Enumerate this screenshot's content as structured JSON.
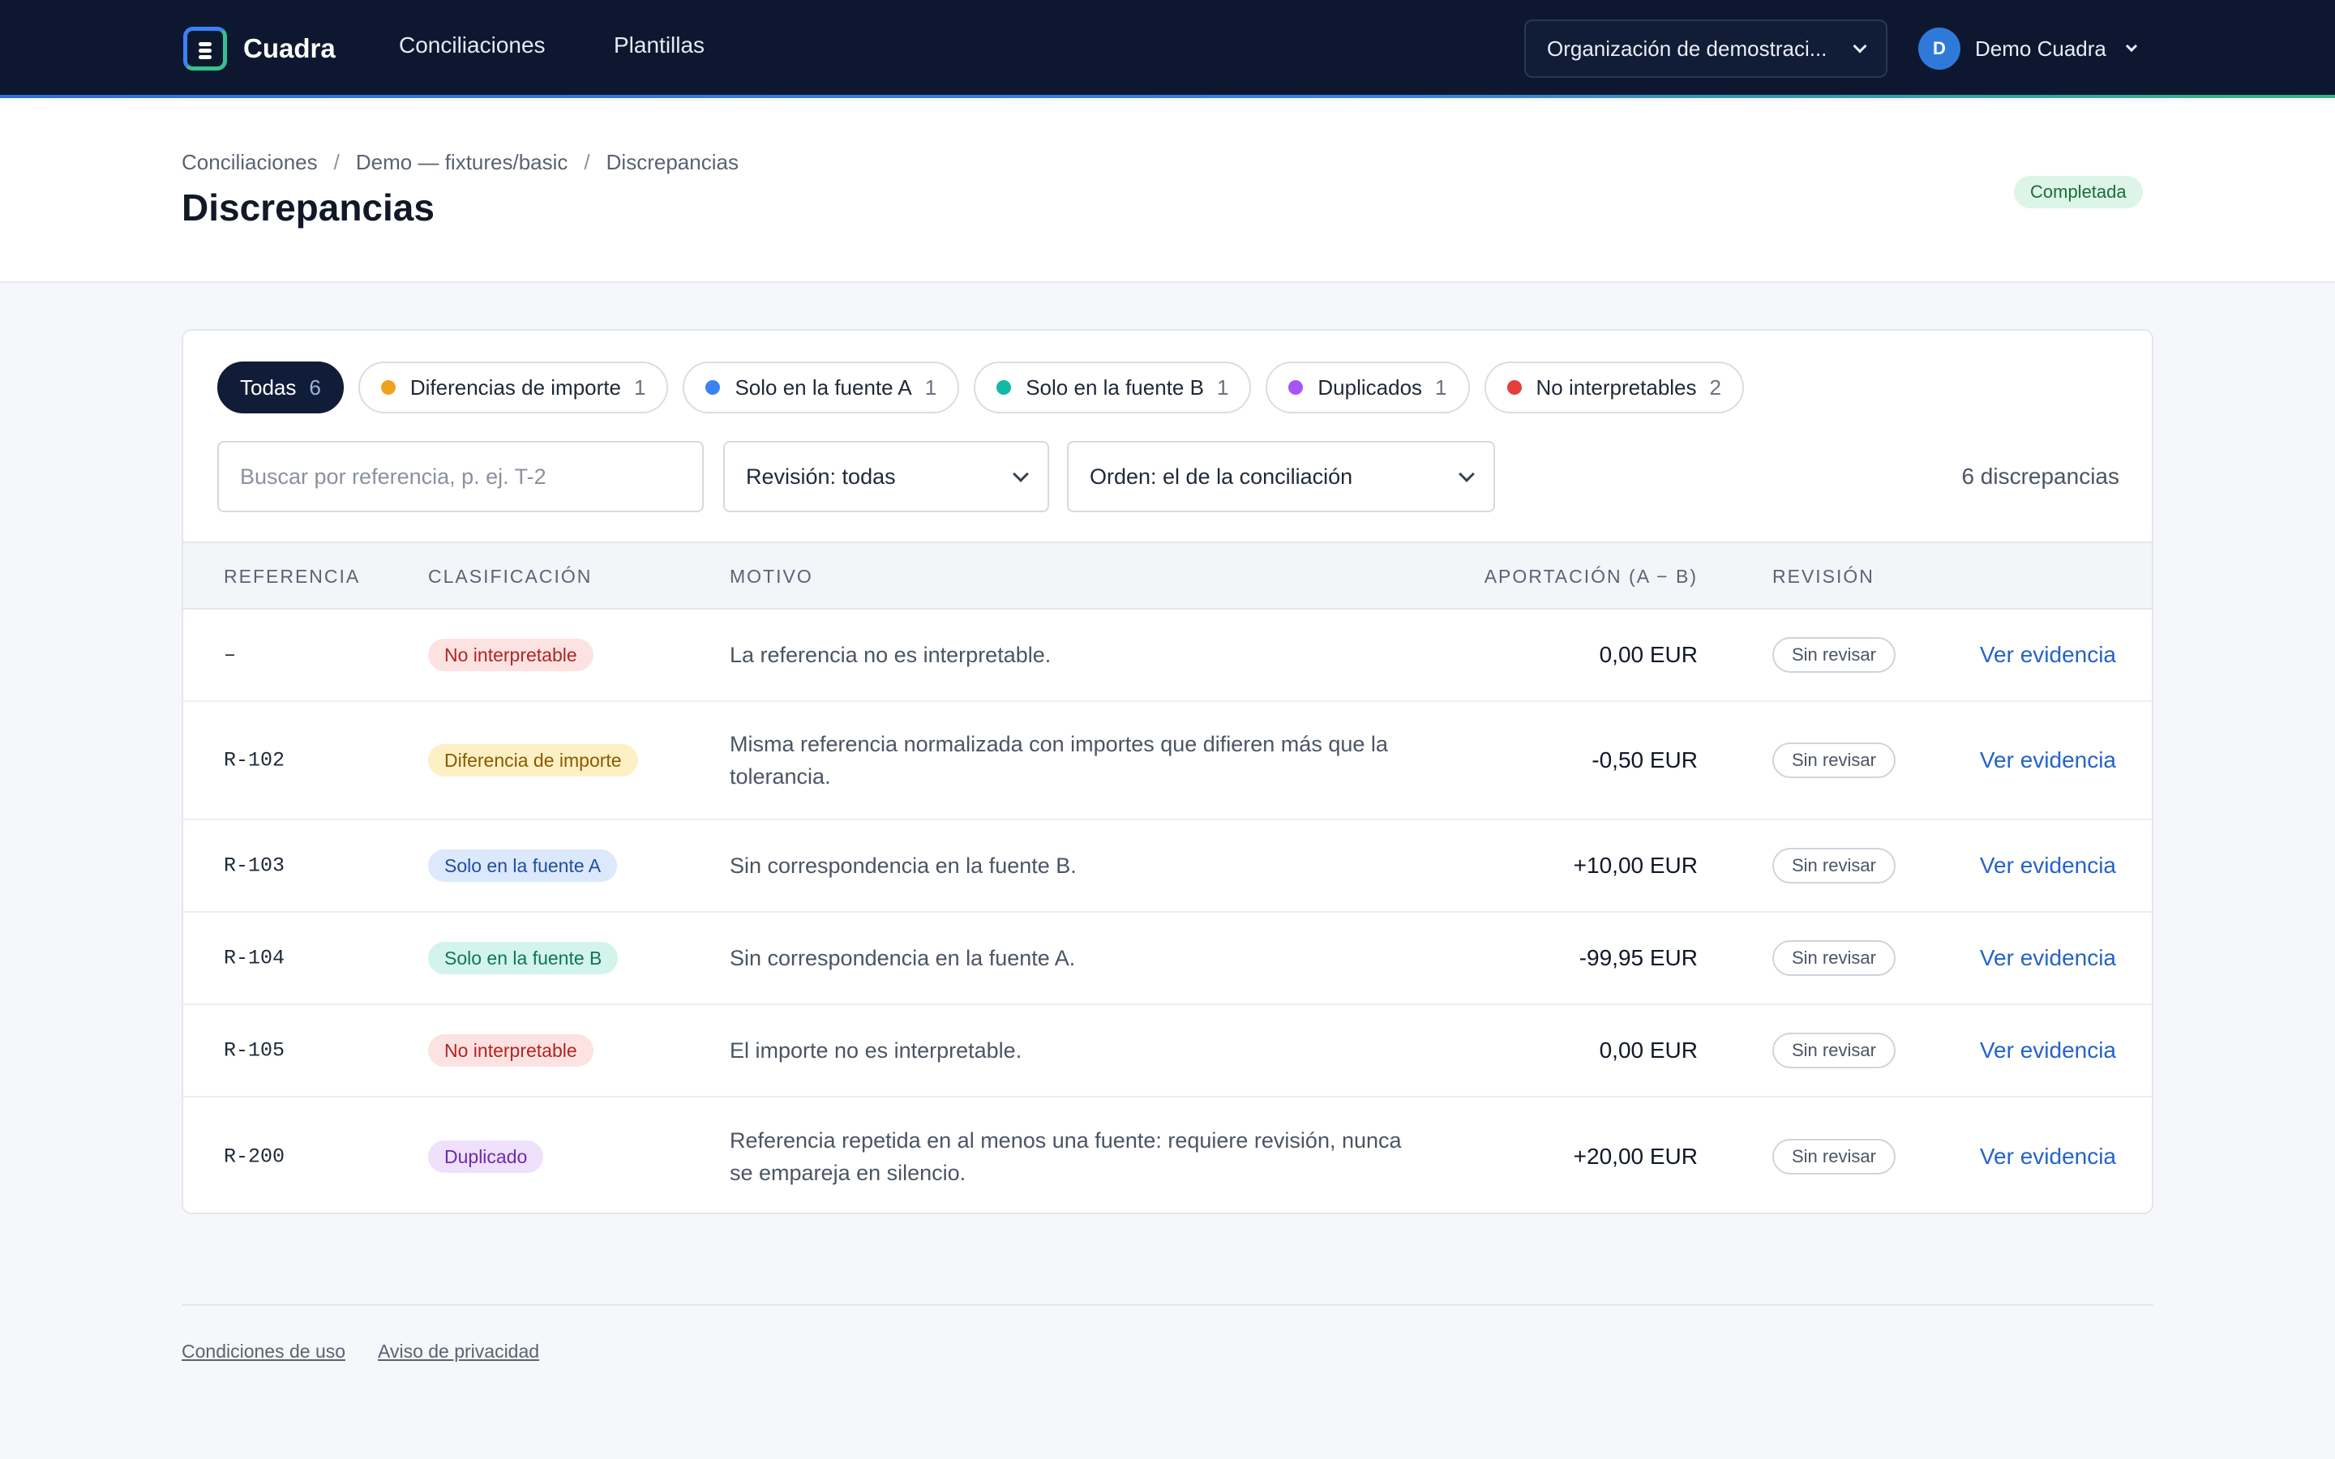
{
  "app": {
    "brand": "Cuadra",
    "nav": [
      "Conciliaciones",
      "Plantillas"
    ],
    "org_selector": "Organización de demostraci...",
    "user": {
      "initial": "D",
      "name": "Demo Cuadra"
    }
  },
  "breadcrumb": [
    "Conciliaciones",
    "Demo — fixtures/basic",
    "Discrepancias"
  ],
  "page": {
    "title": "Discrepancias",
    "status": "Completada"
  },
  "filters": {
    "chips": [
      {
        "label": "Todas",
        "count": "6",
        "color": null,
        "active": true
      },
      {
        "label": "Diferencias de importe",
        "count": "1",
        "color": "#f0a21f",
        "active": false
      },
      {
        "label": "Solo en la fuente A",
        "count": "1",
        "color": "#3b82f6",
        "active": false
      },
      {
        "label": "Solo en la fuente B",
        "count": "1",
        "color": "#14b8a6",
        "active": false
      },
      {
        "label": "Duplicados",
        "count": "1",
        "color": "#a855f7",
        "active": false
      },
      {
        "label": "No interpretables",
        "count": "2",
        "color": "#e53e3e",
        "active": false
      }
    ],
    "search_placeholder": "Buscar por referencia, p. ej. T-2",
    "review_select": "Revisión: todas",
    "order_select": "Orden: el de la conciliación",
    "count_label": "6 discrepancias"
  },
  "table": {
    "headers": {
      "ref": "REFERENCIA",
      "cls": "CLASIFICACIÓN",
      "mot": "MOTIVO",
      "apo": "APORTACIÓN (A − B)",
      "rev": "REVISIÓN"
    },
    "rows": [
      {
        "ref": "–",
        "tag": "No interpretable",
        "tag_kind": "uninterp",
        "motivo": "La referencia no es interpretable.",
        "amount": "0,00 EUR",
        "review": "Sin revisar",
        "action": "Ver evidencia"
      },
      {
        "ref": "R-102",
        "tag": "Diferencia de importe",
        "tag_kind": "diff",
        "motivo": "Misma referencia normalizada con importes que difieren más que la tolerancia.",
        "amount": "-0,50 EUR",
        "review": "Sin revisar",
        "action": "Ver evidencia"
      },
      {
        "ref": "R-103",
        "tag": "Solo en la fuente A",
        "tag_kind": "onlya",
        "motivo": "Sin correspondencia en la fuente B.",
        "amount": "+10,00 EUR",
        "review": "Sin revisar",
        "action": "Ver evidencia"
      },
      {
        "ref": "R-104",
        "tag": "Solo en la fuente B",
        "tag_kind": "onlyb",
        "motivo": "Sin correspondencia en la fuente A.",
        "amount": "-99,95 EUR",
        "review": "Sin revisar",
        "action": "Ver evidencia"
      },
      {
        "ref": "R-105",
        "tag": "No interpretable",
        "tag_kind": "uninterp",
        "motivo": "El importe no es interpretable.",
        "amount": "0,00 EUR",
        "review": "Sin revisar",
        "action": "Ver evidencia"
      },
      {
        "ref": "R-200",
        "tag": "Duplicado",
        "tag_kind": "dup",
        "motivo": "Referencia repetida en al menos una fuente: requiere revisión, nunca se empareja en silencio.",
        "amount": "+20,00 EUR",
        "review": "Sin revisar",
        "action": "Ver evidencia"
      }
    ]
  },
  "tag_colors": {
    "uninterp": {
      "bg": "#fde2e2",
      "fg": "#b42323"
    },
    "diff": {
      "bg": "#fdf0c4",
      "fg": "#8a5a00"
    },
    "onlya": {
      "bg": "#dce8fb",
      "fg": "#1e4fa3"
    },
    "onlyb": {
      "bg": "#d3f4ea",
      "fg": "#11745c"
    },
    "dup": {
      "bg": "#efe0fb",
      "fg": "#6b2bb0"
    }
  },
  "footer": {
    "links": [
      "Condiciones de uso",
      "Aviso de privacidad"
    ]
  }
}
